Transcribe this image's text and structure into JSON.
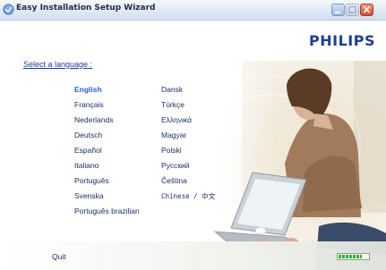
{
  "window": {
    "title": "Easy Installation Setup Wizard"
  },
  "brand": {
    "name": "PHILIPS"
  },
  "prompt": "Select a language :",
  "languages_left": [
    "English",
    "Français",
    "Nederlands",
    "Deutsch",
    "Español",
    "Italiano",
    "Português",
    "Svenska",
    "Português brazilian"
  ],
  "languages_right": [
    "Dansk",
    "Türkçe",
    "Ελληνικά",
    "Magyar",
    "Polski",
    "Русский",
    "Čeština",
    "Chinese / 中文"
  ],
  "selected_language": "English",
  "footer": {
    "quit_label": "Quit",
    "progress_fraction": 0.8
  },
  "colors": {
    "brand": "#1d3f8f",
    "link": "#1d3e94",
    "selected": "#2b5fd0",
    "progress": "#2fb23a"
  },
  "icons": {
    "title": "setup-wizard-icon",
    "minimize": "minimize-icon",
    "maximize": "maximize-icon",
    "close": "close-icon"
  }
}
